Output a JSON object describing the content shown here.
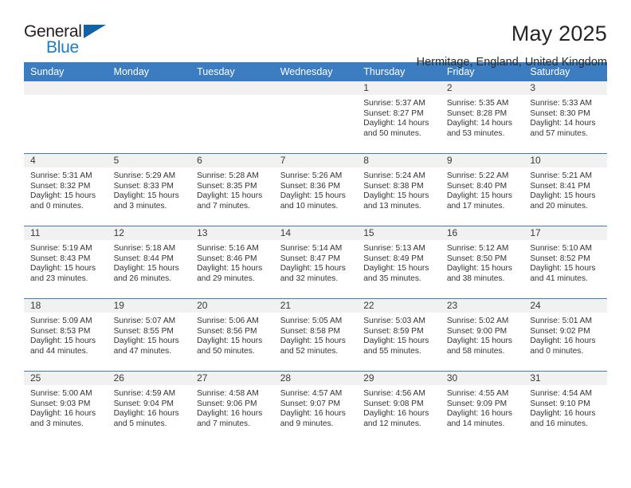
{
  "brand": {
    "name_part1": "General",
    "name_part2": "Blue",
    "triangle_color": "#1163a8",
    "blue_color": "#1b7bc4"
  },
  "header": {
    "title": "May 2025",
    "location": "Hermitage, England, United Kingdom"
  },
  "colors": {
    "header_blue": "#3b7dc0",
    "daynum_band": "#f1f1f1",
    "text": "#333333"
  },
  "calendar": {
    "weekday_headers": [
      "Sunday",
      "Monday",
      "Tuesday",
      "Wednesday",
      "Thursday",
      "Friday",
      "Saturday"
    ],
    "weeks": [
      [
        {
          "day": "",
          "empty": true
        },
        {
          "day": "",
          "empty": true
        },
        {
          "day": "",
          "empty": true
        },
        {
          "day": "",
          "empty": true
        },
        {
          "day": "1",
          "sunrise": "Sunrise: 5:37 AM",
          "sunset": "Sunset: 8:27 PM",
          "daylight": "Daylight: 14 hours and 50 minutes."
        },
        {
          "day": "2",
          "sunrise": "Sunrise: 5:35 AM",
          "sunset": "Sunset: 8:28 PM",
          "daylight": "Daylight: 14 hours and 53 minutes."
        },
        {
          "day": "3",
          "sunrise": "Sunrise: 5:33 AM",
          "sunset": "Sunset: 8:30 PM",
          "daylight": "Daylight: 14 hours and 57 minutes."
        }
      ],
      [
        {
          "day": "4",
          "sunrise": "Sunrise: 5:31 AM",
          "sunset": "Sunset: 8:32 PM",
          "daylight": "Daylight: 15 hours and 0 minutes."
        },
        {
          "day": "5",
          "sunrise": "Sunrise: 5:29 AM",
          "sunset": "Sunset: 8:33 PM",
          "daylight": "Daylight: 15 hours and 3 minutes."
        },
        {
          "day": "6",
          "sunrise": "Sunrise: 5:28 AM",
          "sunset": "Sunset: 8:35 PM",
          "daylight": "Daylight: 15 hours and 7 minutes."
        },
        {
          "day": "7",
          "sunrise": "Sunrise: 5:26 AM",
          "sunset": "Sunset: 8:36 PM",
          "daylight": "Daylight: 15 hours and 10 minutes."
        },
        {
          "day": "8",
          "sunrise": "Sunrise: 5:24 AM",
          "sunset": "Sunset: 8:38 PM",
          "daylight": "Daylight: 15 hours and 13 minutes."
        },
        {
          "day": "9",
          "sunrise": "Sunrise: 5:22 AM",
          "sunset": "Sunset: 8:40 PM",
          "daylight": "Daylight: 15 hours and 17 minutes."
        },
        {
          "day": "10",
          "sunrise": "Sunrise: 5:21 AM",
          "sunset": "Sunset: 8:41 PM",
          "daylight": "Daylight: 15 hours and 20 minutes."
        }
      ],
      [
        {
          "day": "11",
          "sunrise": "Sunrise: 5:19 AM",
          "sunset": "Sunset: 8:43 PM",
          "daylight": "Daylight: 15 hours and 23 minutes."
        },
        {
          "day": "12",
          "sunrise": "Sunrise: 5:18 AM",
          "sunset": "Sunset: 8:44 PM",
          "daylight": "Daylight: 15 hours and 26 minutes."
        },
        {
          "day": "13",
          "sunrise": "Sunrise: 5:16 AM",
          "sunset": "Sunset: 8:46 PM",
          "daylight": "Daylight: 15 hours and 29 minutes."
        },
        {
          "day": "14",
          "sunrise": "Sunrise: 5:14 AM",
          "sunset": "Sunset: 8:47 PM",
          "daylight": "Daylight: 15 hours and 32 minutes."
        },
        {
          "day": "15",
          "sunrise": "Sunrise: 5:13 AM",
          "sunset": "Sunset: 8:49 PM",
          "daylight": "Daylight: 15 hours and 35 minutes."
        },
        {
          "day": "16",
          "sunrise": "Sunrise: 5:12 AM",
          "sunset": "Sunset: 8:50 PM",
          "daylight": "Daylight: 15 hours and 38 minutes."
        },
        {
          "day": "17",
          "sunrise": "Sunrise: 5:10 AM",
          "sunset": "Sunset: 8:52 PM",
          "daylight": "Daylight: 15 hours and 41 minutes."
        }
      ],
      [
        {
          "day": "18",
          "sunrise": "Sunrise: 5:09 AM",
          "sunset": "Sunset: 8:53 PM",
          "daylight": "Daylight: 15 hours and 44 minutes."
        },
        {
          "day": "19",
          "sunrise": "Sunrise: 5:07 AM",
          "sunset": "Sunset: 8:55 PM",
          "daylight": "Daylight: 15 hours and 47 minutes."
        },
        {
          "day": "20",
          "sunrise": "Sunrise: 5:06 AM",
          "sunset": "Sunset: 8:56 PM",
          "daylight": "Daylight: 15 hours and 50 minutes."
        },
        {
          "day": "21",
          "sunrise": "Sunrise: 5:05 AM",
          "sunset": "Sunset: 8:58 PM",
          "daylight": "Daylight: 15 hours and 52 minutes."
        },
        {
          "day": "22",
          "sunrise": "Sunrise: 5:03 AM",
          "sunset": "Sunset: 8:59 PM",
          "daylight": "Daylight: 15 hours and 55 minutes."
        },
        {
          "day": "23",
          "sunrise": "Sunrise: 5:02 AM",
          "sunset": "Sunset: 9:00 PM",
          "daylight": "Daylight: 15 hours and 58 minutes."
        },
        {
          "day": "24",
          "sunrise": "Sunrise: 5:01 AM",
          "sunset": "Sunset: 9:02 PM",
          "daylight": "Daylight: 16 hours and 0 minutes."
        }
      ],
      [
        {
          "day": "25",
          "sunrise": "Sunrise: 5:00 AM",
          "sunset": "Sunset: 9:03 PM",
          "daylight": "Daylight: 16 hours and 3 minutes."
        },
        {
          "day": "26",
          "sunrise": "Sunrise: 4:59 AM",
          "sunset": "Sunset: 9:04 PM",
          "daylight": "Daylight: 16 hours and 5 minutes."
        },
        {
          "day": "27",
          "sunrise": "Sunrise: 4:58 AM",
          "sunset": "Sunset: 9:06 PM",
          "daylight": "Daylight: 16 hours and 7 minutes."
        },
        {
          "day": "28",
          "sunrise": "Sunrise: 4:57 AM",
          "sunset": "Sunset: 9:07 PM",
          "daylight": "Daylight: 16 hours and 9 minutes."
        },
        {
          "day": "29",
          "sunrise": "Sunrise: 4:56 AM",
          "sunset": "Sunset: 9:08 PM",
          "daylight": "Daylight: 16 hours and 12 minutes."
        },
        {
          "day": "30",
          "sunrise": "Sunrise: 4:55 AM",
          "sunset": "Sunset: 9:09 PM",
          "daylight": "Daylight: 16 hours and 14 minutes."
        },
        {
          "day": "31",
          "sunrise": "Sunrise: 4:54 AM",
          "sunset": "Sunset: 9:10 PM",
          "daylight": "Daylight: 16 hours and 16 minutes."
        }
      ]
    ]
  }
}
